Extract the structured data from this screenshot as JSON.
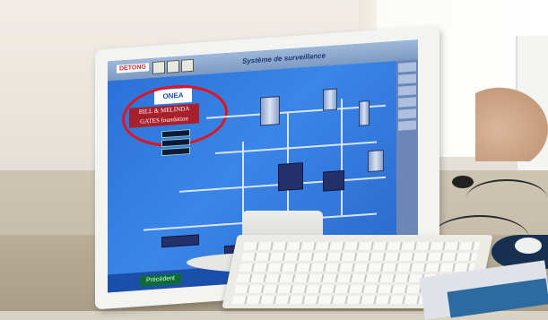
{
  "screen": {
    "brand_logo": "DETONG",
    "title": "Système de surveillance",
    "onea_label": "ONEA",
    "sponsor_line1": "BILL & MELINDA",
    "sponsor_line2": "GATES foundation",
    "precedent_button": "Précédent"
  },
  "colors": {
    "screen_blue": "#2b6fd6",
    "highlight_circle": "#e0141e",
    "sponsor_red": "#a8202a"
  }
}
